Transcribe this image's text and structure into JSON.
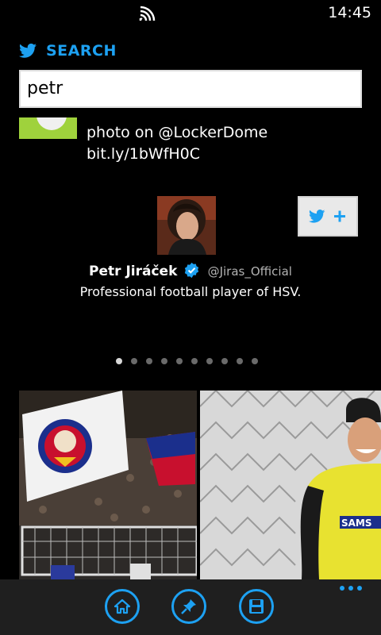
{
  "status_bar": {
    "time": "14:45"
  },
  "header": {
    "title": "SEARCH"
  },
  "search": {
    "value": "petr"
  },
  "tweet": {
    "line1": "photo on @LockerDome",
    "line2": "bit.ly/1bWfH0C"
  },
  "profile": {
    "name": "Petr Jiráček",
    "handle": "@Jiras_Official",
    "bio": "Professional football player of HSV.",
    "verified": true
  },
  "pager": {
    "total": 10,
    "active_index": 0
  },
  "app_bar": {
    "buttons": [
      "home-icon",
      "pin-icon",
      "save-icon"
    ]
  },
  "colors": {
    "accent": "#1da1f2",
    "background": "#000000",
    "appbar": "#1f1f1f"
  }
}
